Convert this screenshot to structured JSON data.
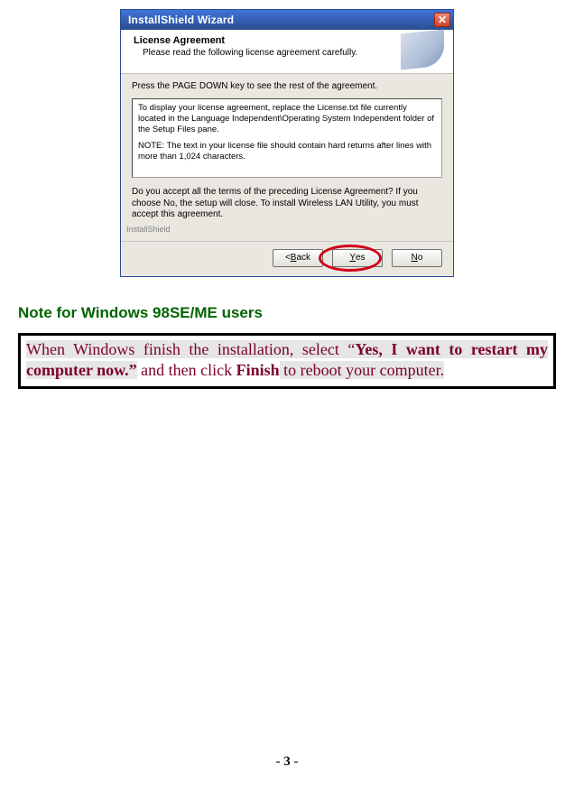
{
  "dialog": {
    "title": "InstallShield Wizard",
    "close_glyph": "✕",
    "header_title": "License Agreement",
    "header_sub": "Please read the following license agreement carefully.",
    "instruction": "Press the PAGE DOWN key to see the rest of the agreement.",
    "textarea_p1": "To display your license agreement, replace the License.txt file currently located in the Language Independent\\Operating System Independent folder of the Setup Files pane.",
    "textarea_p2": "NOTE: The text in your license file should contain hard returns after lines with more than 1,024 characters.",
    "accept_text": "Do you accept all the terms of the preceding License Agreement? If you choose No, the setup will close. To install Wireless LAN Utility, you must accept this agreement.",
    "brand": "InstallShield",
    "btn_back_pre": "< ",
    "btn_back_u": "B",
    "btn_back_rest": "ack",
    "btn_yes_u": "Y",
    "btn_yes_rest": "es",
    "btn_no_u": "N",
    "btn_no_rest": "o"
  },
  "note_heading": "Note for Windows 98SE/ME users",
  "note_box": {
    "pre": "When Windows finish the installation, select “",
    "bold1": "Yes, I want to restart my computer now.”",
    "mid": " and then click ",
    "bold2": "Finish",
    "post": " to reboot your computer."
  },
  "page_number": "3"
}
